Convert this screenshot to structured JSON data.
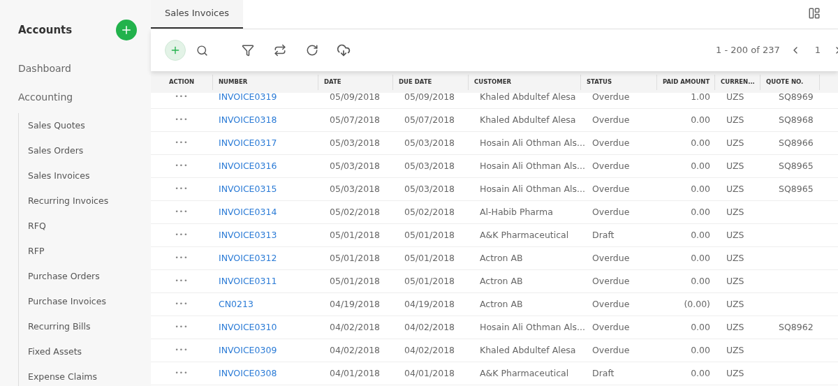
{
  "sidebar": {
    "title": "Accounts",
    "top_items": [
      "Dashboard",
      "Accounting"
    ],
    "items": [
      {
        "label": "Sales Quotes"
      },
      {
        "label": "Sales Orders"
      },
      {
        "label": "Sales Invoices"
      },
      {
        "label": "Recurring Invoices"
      },
      {
        "label": "RFQ"
      },
      {
        "label": "RFP"
      },
      {
        "label": "Purchase Orders"
      },
      {
        "label": "Purchase Invoices"
      },
      {
        "label": "Recurring Bills"
      },
      {
        "label": "Fixed Assets"
      },
      {
        "label": "Expense Claims"
      }
    ]
  },
  "tabs": [
    {
      "label": "Sales Invoices",
      "selected": true
    }
  ],
  "pagination": {
    "range": "1 - 200 of 237",
    "page": "1"
  },
  "table": {
    "columns": [
      "ACTION",
      "NUMBER",
      "DATE",
      "DUE DATE",
      "CUSTOMER",
      "STATUS",
      "PAID AMOUNT",
      "CURREN...",
      "QUOTE NO."
    ],
    "rows": [
      {
        "action": "•••",
        "number": "INVOICE0319",
        "date": "05/09/2018",
        "due_date": "05/09/2018",
        "customer": "Khaled Abdultef Alesa",
        "status": "Overdue",
        "paid_amount": "1.00",
        "currency": "UZS",
        "quote_no": "SQ8969"
      },
      {
        "action": "•••",
        "number": "INVOICE0318",
        "date": "05/07/2018",
        "due_date": "05/07/2018",
        "customer": "Khaled Abdultef Alesa",
        "status": "Overdue",
        "paid_amount": "0.00",
        "currency": "UZS",
        "quote_no": "SQ8968"
      },
      {
        "action": "•••",
        "number": "INVOICE0317",
        "date": "05/03/2018",
        "due_date": "05/03/2018",
        "customer": "Hosain Ali Othman Als...",
        "status": "Overdue",
        "paid_amount": "0.00",
        "currency": "UZS",
        "quote_no": "SQ8966"
      },
      {
        "action": "•••",
        "number": "INVOICE0316",
        "date": "05/03/2018",
        "due_date": "05/03/2018",
        "customer": "Hosain Ali Othman Als...",
        "status": "Overdue",
        "paid_amount": "0.00",
        "currency": "UZS",
        "quote_no": "SQ8965"
      },
      {
        "action": "•••",
        "number": "INVOICE0315",
        "date": "05/03/2018",
        "due_date": "05/03/2018",
        "customer": "Hosain Ali Othman Als...",
        "status": "Overdue",
        "paid_amount": "0.00",
        "currency": "UZS",
        "quote_no": "SQ8965"
      },
      {
        "action": "•••",
        "number": "INVOICE0314",
        "date": "05/02/2018",
        "due_date": "05/02/2018",
        "customer": "Al-Habib Pharma",
        "status": "Overdue",
        "paid_amount": "0.00",
        "currency": "UZS"
      },
      {
        "action": "•••",
        "number": "INVOICE0313",
        "date": "05/01/2018",
        "due_date": "05/01/2018",
        "customer": "A&K Pharmaceutical",
        "status": "Draft",
        "paid_amount": "0.00",
        "currency": "UZS"
      },
      {
        "action": "•••",
        "number": "INVOICE0312",
        "date": "05/01/2018",
        "due_date": "05/01/2018",
        "customer": "Actron AB",
        "status": "Overdue",
        "paid_amount": "0.00",
        "currency": "UZS"
      },
      {
        "action": "•••",
        "number": "INVOICE0311",
        "date": "05/01/2018",
        "due_date": "05/01/2018",
        "customer": "Actron AB",
        "status": "Overdue",
        "paid_amount": "0.00",
        "currency": "UZS"
      },
      {
        "action": "•••",
        "number": "CN0213",
        "date": "04/19/2018",
        "due_date": "04/19/2018",
        "customer": "Actron AB",
        "status": "Overdue",
        "paid_amount": "(0.00)",
        "currency": "UZS"
      },
      {
        "action": "•••",
        "number": "INVOICE0310",
        "date": "04/02/2018",
        "due_date": "04/02/2018",
        "customer": "Hosain Ali Othman Als...",
        "status": "Overdue",
        "paid_amount": "0.00",
        "currency": "UZS",
        "quote_no": "SQ8962"
      },
      {
        "action": "•••",
        "number": "INVOICE0309",
        "date": "04/02/2018",
        "due_date": "04/02/2018",
        "customer": "Khaled Abdultef Alesa",
        "status": "Overdue",
        "paid_amount": "0.00",
        "currency": "UZS"
      },
      {
        "action": "•••",
        "number": "INVOICE0308",
        "date": "04/01/2018",
        "due_date": "04/01/2018",
        "customer": "A&K Pharmaceutical",
        "status": "Draft",
        "paid_amount": "0.00",
        "currency": "UZS"
      }
    ]
  }
}
